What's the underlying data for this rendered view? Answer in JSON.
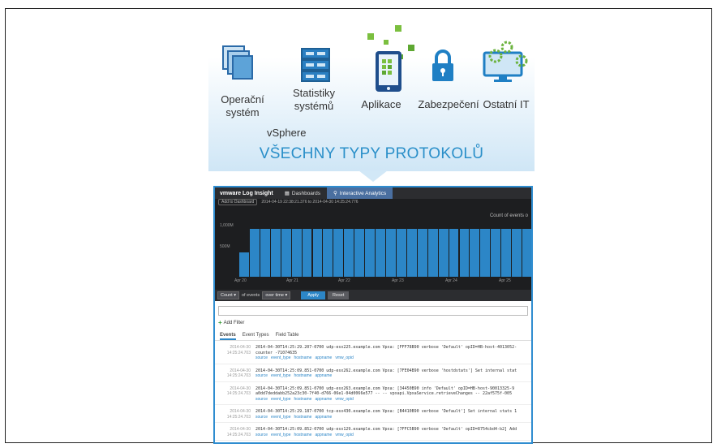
{
  "categories": [
    {
      "label": "Operační\nsystém",
      "icon": "stacked-windows-icon"
    },
    {
      "label": "Statistiky\nsystémů",
      "icon": "server-rack-icon"
    },
    {
      "label": "Aplikace",
      "icon": "tablet-apps-icon"
    },
    {
      "label": "Zabezpečení",
      "icon": "padlock-icon"
    },
    {
      "label": "Ostatní IT",
      "icon": "monitor-gears-icon"
    }
  ],
  "vsphere_label": "vSphere",
  "headline": "VŠECHNY TYPY PROTOKOLŮ",
  "app": {
    "brand": "vmware Log Insight",
    "tabs": [
      {
        "label": "Dashboards",
        "icon": "dashboard-icon"
      },
      {
        "label": "Interactive Analytics",
        "icon": "search-icon"
      }
    ],
    "add_to_dashboard": "Add to Dashboard",
    "time_range": "2014-04-19 22:38:21.376 to 2014-04-30 14:25:24.776",
    "chart_title": "Count of events o",
    "controls": {
      "count": "Count",
      "of_events": "of events",
      "over_time": "over time",
      "apply": "Apply",
      "reset": "Reset"
    },
    "add_filter": "Add Filter",
    "result_tabs": [
      "Events",
      "Event Types",
      "Field Table"
    ],
    "events": [
      {
        "date": "2014-04-30",
        "time": "14:25:24.703",
        "lines": [
          "2014-04-30T14:25:29.207-0700 udp-esx225.example.com Vpxa: [FFF78B90 verbose 'Default' opID=HB-host-4013052-",
          "counter -71074635"
        ],
        "fields": [
          "source",
          "event_type",
          "hostname",
          "appname",
          "vmw_opid"
        ]
      },
      {
        "date": "2014-04-30",
        "time": "14:25:24.703",
        "lines": [
          "2014-04-30T14:25:09.851-0700 udp-esx262.example.com Vpxa: [7FE04B90 verbose 'hostdstats'] Set internal stat"
        ],
        "fields": [
          "source",
          "event_type",
          "hostname",
          "appname"
        ]
      },
      {
        "date": "2014-04-30",
        "time": "14:25:24.703",
        "lines": [
          "2014-04-30T14:25:09.851-0700 udp-esx263.example.com Vpxa: [34450B90 info 'Default' opID=HB-host-90013325-9",
          "a0dd7deddabb252a23c30-7f40-d766-06e1-04d0066e577 -- -- vpxapi.VpxaService.retrieveChanges -- 22af575f-005"
        ],
        "fields": [
          "source",
          "event_type",
          "hostname",
          "appname",
          "vmw_opid"
        ]
      },
      {
        "date": "2014-04-30",
        "time": "14:25:24.703",
        "lines": [
          "2014-04-30T14:25:29.187-0700 tcp-esx430.example.com Vpxa: [B4410B90 verbose 'Default'] Set internal stats 1"
        ],
        "fields": [
          "source",
          "event_type",
          "hostname",
          "appname"
        ]
      },
      {
        "date": "2014-04-30",
        "time": "14:25:24.703",
        "lines": [
          "2014-04-30T14:25:09.852-0700 udp-esx129.example.com Vpxa: [7FFC5B90 verbose 'Default' opID=8754cbd4-b2] Add"
        ],
        "fields": [
          "source",
          "event_type",
          "hostname",
          "appname",
          "vmw_opid"
        ]
      }
    ],
    "chart_data": {
      "type": "bar",
      "x_ticks": [
        "Apr 20",
        "Apr 21",
        "Apr 22",
        "Apr 23",
        "Apr 24",
        "Apr 25"
      ],
      "y_ticks": [
        "1,000M",
        "500M"
      ],
      "values": [
        0.45,
        0.88,
        0.88,
        0.88,
        0.88,
        0.88,
        0.88,
        0.88,
        0.88,
        0.88,
        0.88,
        0.88,
        0.88,
        0.88,
        0.88,
        0.88,
        0.88,
        0.88,
        0.88,
        0.88,
        0.88,
        0.88,
        0.88,
        0.88,
        0.88,
        0.88,
        0.88,
        0.88
      ],
      "ylim": [
        0,
        1.2
      ]
    },
    "colors": {
      "accent": "#2c86c7",
      "chart_bg": "#1d1e20",
      "nav_bg": "#2c2d30"
    }
  }
}
